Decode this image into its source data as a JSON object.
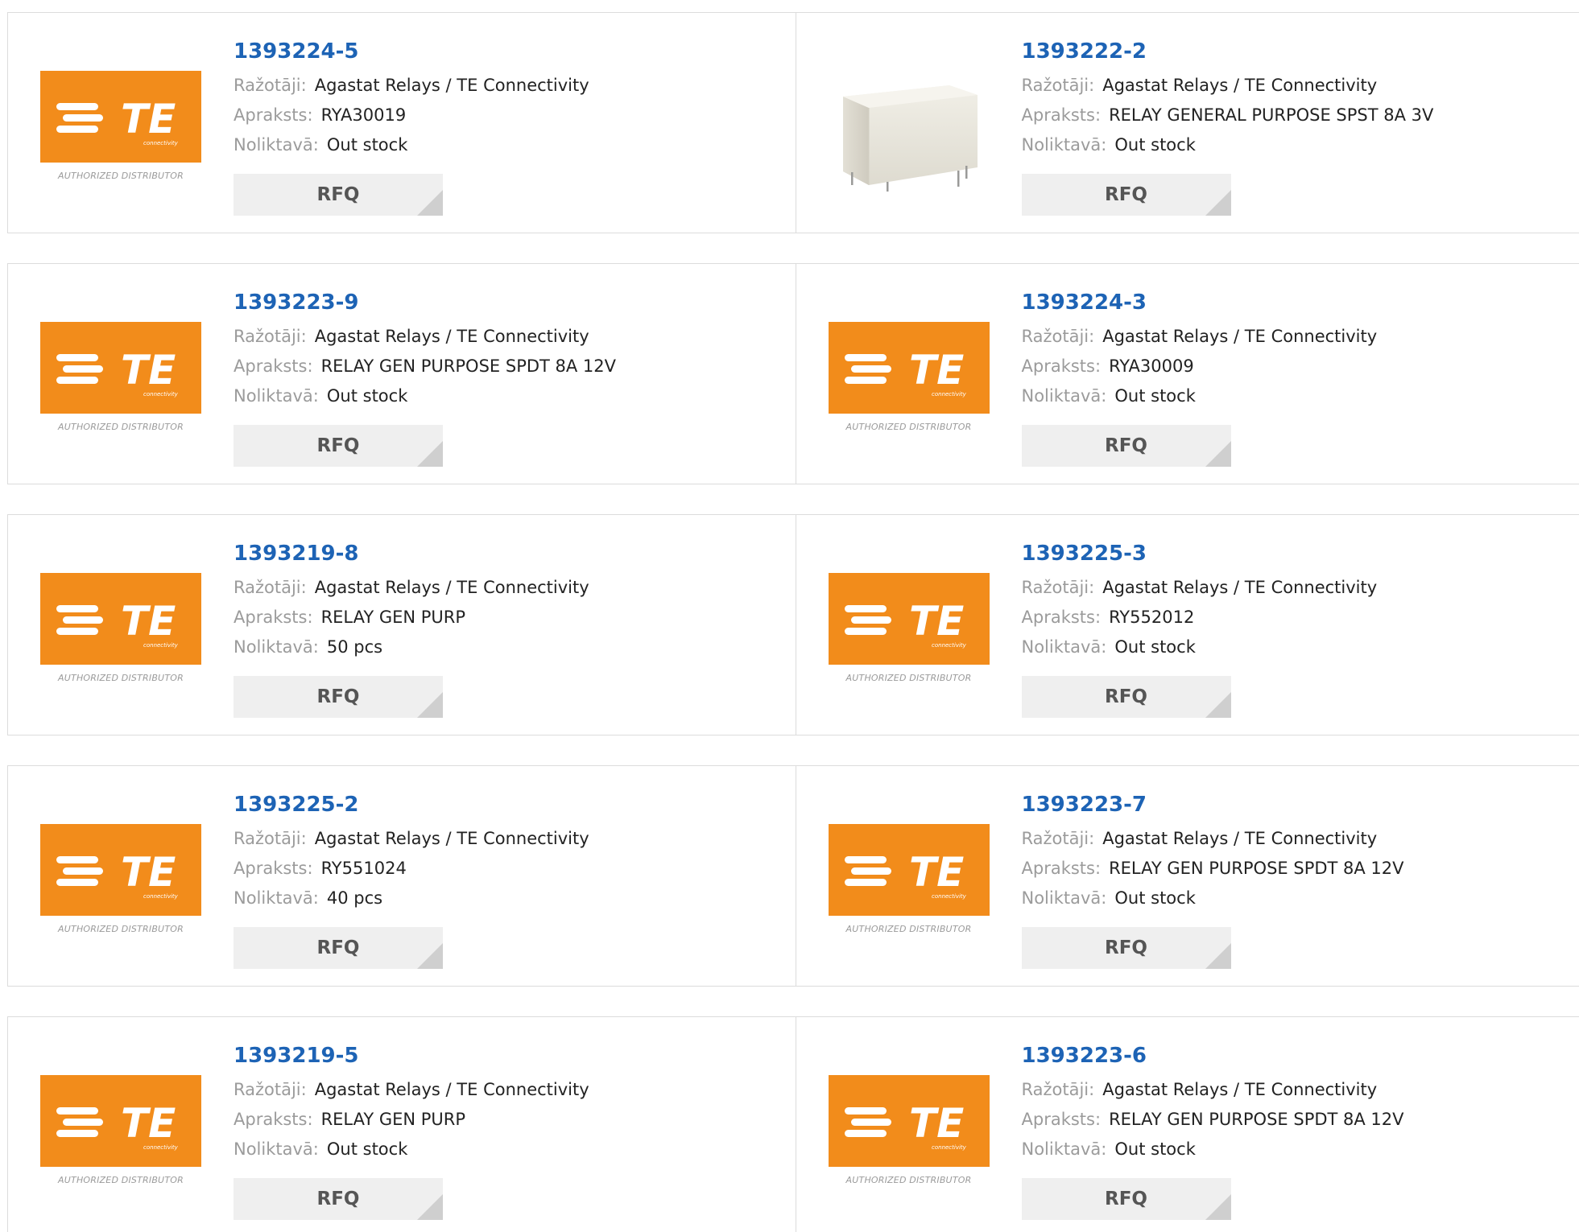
{
  "labels": {
    "manufacturer": "Ražotāji:",
    "description": "Apraksts:",
    "stock": "Noliktavā:",
    "rfq": "RFQ",
    "logo_subtext": "connectivity",
    "logo_tagline": "AUTHORIZED DISTRIBUTOR",
    "logo_brand": "TE"
  },
  "colors": {
    "te_orange": "#f28c1b",
    "part_link": "#1d63b5",
    "label_gray": "#9b9b9b",
    "button_bg": "#efefef"
  },
  "products": [
    {
      "part": "1393224-5",
      "manufacturer": "Agastat Relays / TE Connectivity",
      "description": "RYA30019",
      "stock": "Out stock",
      "image": "te-logo"
    },
    {
      "part": "1393222-2",
      "manufacturer": "Agastat Relays / TE Connectivity",
      "description": "RELAY GENERAL PURPOSE SPST 8A 3V",
      "stock": "Out stock",
      "image": "relay-photo"
    },
    {
      "part": "1393223-9",
      "manufacturer": "Agastat Relays / TE Connectivity",
      "description": "RELAY GEN PURPOSE SPDT 8A 12V",
      "stock": "Out stock",
      "image": "te-logo"
    },
    {
      "part": "1393224-3",
      "manufacturer": "Agastat Relays / TE Connectivity",
      "description": "RYA30009",
      "stock": "Out stock",
      "image": "te-logo"
    },
    {
      "part": "1393219-8",
      "manufacturer": "Agastat Relays / TE Connectivity",
      "description": "RELAY GEN PURP",
      "stock": "50 pcs",
      "image": "te-logo"
    },
    {
      "part": "1393225-3",
      "manufacturer": "Agastat Relays / TE Connectivity",
      "description": "RY552012",
      "stock": "Out stock",
      "image": "te-logo"
    },
    {
      "part": "1393225-2",
      "manufacturer": "Agastat Relays / TE Connectivity",
      "description": "RY551024",
      "stock": "40 pcs",
      "image": "te-logo"
    },
    {
      "part": "1393223-7",
      "manufacturer": "Agastat Relays / TE Connectivity",
      "description": "RELAY GEN PURPOSE SPDT 8A 12V",
      "stock": "Out stock",
      "image": "te-logo"
    },
    {
      "part": "1393219-5",
      "manufacturer": "Agastat Relays / TE Connectivity",
      "description": "RELAY GEN PURP",
      "stock": "Out stock",
      "image": "te-logo"
    },
    {
      "part": "1393223-6",
      "manufacturer": "Agastat Relays / TE Connectivity",
      "description": "RELAY GEN PURPOSE SPDT 8A 12V",
      "stock": "Out stock",
      "image": "te-logo"
    }
  ]
}
